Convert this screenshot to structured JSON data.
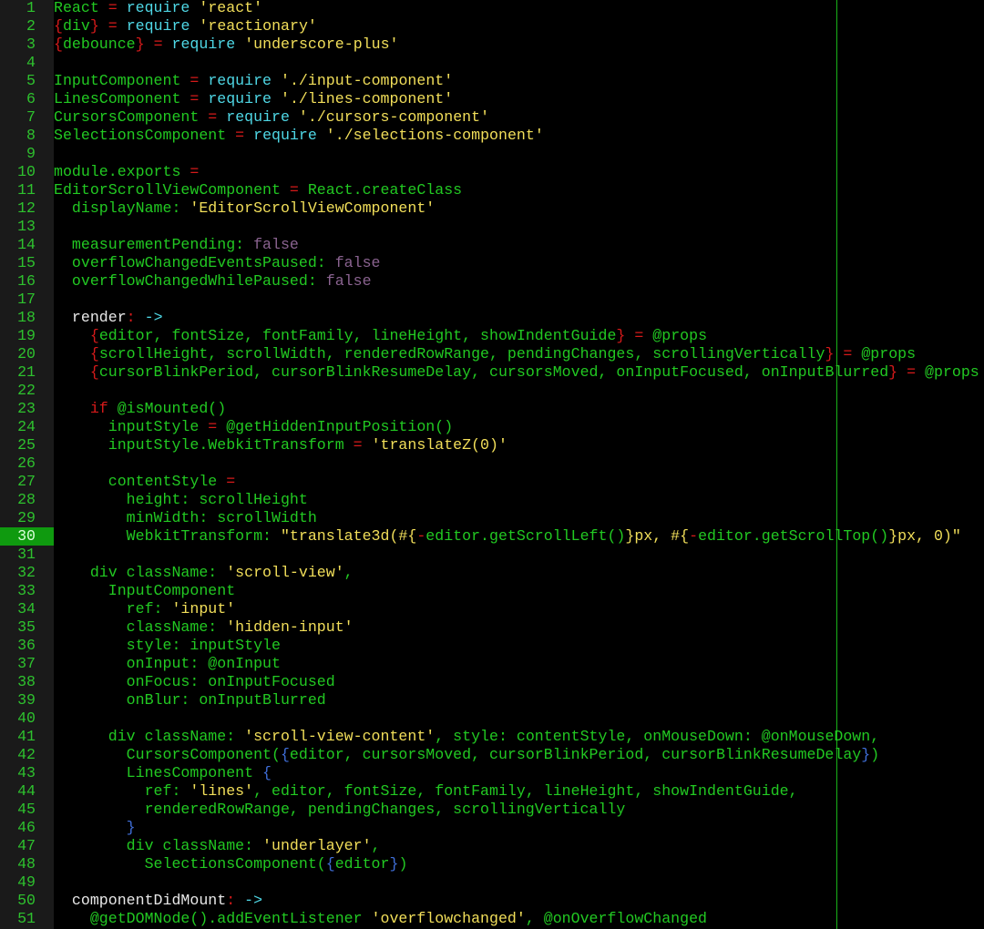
{
  "editor": {
    "cursor_line": 30,
    "colors": {
      "background": "#000000",
      "gutter_bg": "#1a1a1a",
      "line_number": "#2ec22e",
      "current_line_bg": "#0f9a0f",
      "identifier": "#22c922",
      "string": "#f2df5a",
      "keyword": "#4fd8e6",
      "operator": "#d61a1a",
      "boolean": "#8a6390",
      "brace": "#3f6ed8",
      "method_name": "#e8e8e8",
      "wrap_guide": "#19b419"
    },
    "lines": [
      {
        "n": "1",
        "tokens": [
          [
            "def",
            "React "
          ],
          [
            "op",
            "="
          ],
          [
            "def",
            " "
          ],
          [
            "kw",
            "require"
          ],
          [
            "def",
            " "
          ],
          [
            "str",
            "'react'"
          ]
        ]
      },
      {
        "n": "2",
        "tokens": [
          [
            "op",
            "{"
          ],
          [
            "def",
            "div"
          ],
          [
            "op",
            "}"
          ],
          [
            "def",
            " "
          ],
          [
            "op",
            "="
          ],
          [
            "def",
            " "
          ],
          [
            "kw",
            "require"
          ],
          [
            "def",
            " "
          ],
          [
            "str",
            "'reactionary'"
          ]
        ]
      },
      {
        "n": "3",
        "tokens": [
          [
            "op",
            "{"
          ],
          [
            "def",
            "debounce"
          ],
          [
            "op",
            "}"
          ],
          [
            "def",
            " "
          ],
          [
            "op",
            "="
          ],
          [
            "def",
            " "
          ],
          [
            "kw",
            "require"
          ],
          [
            "def",
            " "
          ],
          [
            "str",
            "'underscore-plus'"
          ]
        ]
      },
      {
        "n": "4",
        "tokens": []
      },
      {
        "n": "5",
        "tokens": [
          [
            "def",
            "InputComponent "
          ],
          [
            "op",
            "="
          ],
          [
            "def",
            " "
          ],
          [
            "kw",
            "require"
          ],
          [
            "def",
            " "
          ],
          [
            "str",
            "'./input-component'"
          ]
        ]
      },
      {
        "n": "6",
        "tokens": [
          [
            "def",
            "LinesComponent "
          ],
          [
            "op",
            "="
          ],
          [
            "def",
            " "
          ],
          [
            "kw",
            "require"
          ],
          [
            "def",
            " "
          ],
          [
            "str",
            "'./lines-component'"
          ]
        ]
      },
      {
        "n": "7",
        "tokens": [
          [
            "def",
            "CursorsComponent "
          ],
          [
            "op",
            "="
          ],
          [
            "def",
            " "
          ],
          [
            "kw",
            "require"
          ],
          [
            "def",
            " "
          ],
          [
            "str",
            "'./cursors-component'"
          ]
        ]
      },
      {
        "n": "8",
        "tokens": [
          [
            "def",
            "SelectionsComponent "
          ],
          [
            "op",
            "="
          ],
          [
            "def",
            " "
          ],
          [
            "kw",
            "require"
          ],
          [
            "def",
            " "
          ],
          [
            "str",
            "'./selections-component'"
          ]
        ]
      },
      {
        "n": "9",
        "tokens": []
      },
      {
        "n": "10",
        "tokens": [
          [
            "def",
            "module.exports "
          ],
          [
            "op",
            "="
          ]
        ]
      },
      {
        "n": "11",
        "tokens": [
          [
            "def",
            "EditorScrollViewComponent "
          ],
          [
            "op",
            "="
          ],
          [
            "def",
            " React.createClass"
          ]
        ]
      },
      {
        "n": "12",
        "tokens": [
          [
            "def",
            "  displayName: "
          ],
          [
            "str",
            "'EditorScrollViewComponent'"
          ]
        ]
      },
      {
        "n": "13",
        "tokens": []
      },
      {
        "n": "14",
        "tokens": [
          [
            "def",
            "  measurementPending: "
          ],
          [
            "bool",
            "false"
          ]
        ]
      },
      {
        "n": "15",
        "tokens": [
          [
            "def",
            "  overflowChangedEventsPaused: "
          ],
          [
            "bool",
            "false"
          ]
        ]
      },
      {
        "n": "16",
        "tokens": [
          [
            "def",
            "  overflowChangedWhilePaused: "
          ],
          [
            "bool",
            "false"
          ]
        ]
      },
      {
        "n": "17",
        "tokens": []
      },
      {
        "n": "18",
        "tokens": [
          [
            "wh",
            "  render"
          ],
          [
            "op",
            ":"
          ],
          [
            "def",
            " "
          ],
          [
            "ar",
            "->"
          ]
        ]
      },
      {
        "n": "19",
        "tokens": [
          [
            "def",
            "    "
          ],
          [
            "op",
            "{"
          ],
          [
            "def",
            "editor, fontSize, fontFamily, lineHeight, showIndentGuide"
          ],
          [
            "op",
            "}"
          ],
          [
            "def",
            " "
          ],
          [
            "op",
            "="
          ],
          [
            "def",
            " @props"
          ]
        ]
      },
      {
        "n": "20",
        "tokens": [
          [
            "def",
            "    "
          ],
          [
            "op",
            "{"
          ],
          [
            "def",
            "scrollHeight, scrollWidth, renderedRowRange, pendingChanges, scrollingVertically"
          ],
          [
            "op",
            "}"
          ],
          [
            "def",
            " "
          ],
          [
            "op",
            "="
          ],
          [
            "def",
            " @props"
          ]
        ]
      },
      {
        "n": "21",
        "tokens": [
          [
            "def",
            "    "
          ],
          [
            "op",
            "{"
          ],
          [
            "def",
            "cursorBlinkPeriod, cursorBlinkResumeDelay, cursorsMoved, onInputFocused, onInputBlurred"
          ],
          [
            "op",
            "}"
          ],
          [
            "def",
            " "
          ],
          [
            "op",
            "="
          ],
          [
            "def",
            " @props"
          ]
        ]
      },
      {
        "n": "22",
        "tokens": []
      },
      {
        "n": "23",
        "tokens": [
          [
            "def",
            "    "
          ],
          [
            "if",
            "if"
          ],
          [
            "def",
            " @isMounted()"
          ]
        ]
      },
      {
        "n": "24",
        "tokens": [
          [
            "def",
            "      inputStyle "
          ],
          [
            "op",
            "="
          ],
          [
            "def",
            " @getHiddenInputPosition()"
          ]
        ]
      },
      {
        "n": "25",
        "tokens": [
          [
            "def",
            "      inputStyle.WebkitTransform "
          ],
          [
            "op",
            "="
          ],
          [
            "def",
            " "
          ],
          [
            "str",
            "'translateZ(0)'"
          ]
        ]
      },
      {
        "n": "26",
        "tokens": []
      },
      {
        "n": "27",
        "tokens": [
          [
            "def",
            "      contentStyle "
          ],
          [
            "op",
            "="
          ]
        ]
      },
      {
        "n": "28",
        "tokens": [
          [
            "def",
            "        height: scrollHeight"
          ]
        ]
      },
      {
        "n": "29",
        "tokens": [
          [
            "def",
            "        minWidth: scrollWidth"
          ]
        ]
      },
      {
        "n": "30",
        "tokens": [
          [
            "def",
            "        WebkitTransform: "
          ],
          [
            "str",
            "\"translate3d(#{"
          ],
          [
            "op",
            "-"
          ],
          [
            "def",
            "editor.getScrollLeft()"
          ],
          [
            "str",
            "}px, #{"
          ],
          [
            "op",
            "-"
          ],
          [
            "def",
            "editor.getScrollTop()"
          ],
          [
            "str",
            "}px, 0)\""
          ]
        ]
      },
      {
        "n": "31",
        "tokens": []
      },
      {
        "n": "32",
        "tokens": [
          [
            "def",
            "    div className: "
          ],
          [
            "str",
            "'scroll-view'"
          ],
          [
            "def",
            ","
          ]
        ]
      },
      {
        "n": "33",
        "tokens": [
          [
            "def",
            "      InputComponent"
          ]
        ]
      },
      {
        "n": "34",
        "tokens": [
          [
            "def",
            "        ref: "
          ],
          [
            "str",
            "'input'"
          ]
        ]
      },
      {
        "n": "35",
        "tokens": [
          [
            "def",
            "        className: "
          ],
          [
            "str",
            "'hidden-input'"
          ]
        ]
      },
      {
        "n": "36",
        "tokens": [
          [
            "def",
            "        style: inputStyle"
          ]
        ]
      },
      {
        "n": "37",
        "tokens": [
          [
            "def",
            "        onInput: @onInput"
          ]
        ]
      },
      {
        "n": "38",
        "tokens": [
          [
            "def",
            "        onFocus: onInputFocused"
          ]
        ]
      },
      {
        "n": "39",
        "tokens": [
          [
            "def",
            "        onBlur: onInputBlurred"
          ]
        ]
      },
      {
        "n": "40",
        "tokens": []
      },
      {
        "n": "41",
        "tokens": [
          [
            "def",
            "      div className: "
          ],
          [
            "str",
            "'scroll-view-content'"
          ],
          [
            "def",
            ", style: contentStyle, onMouseDown: @onMouseDown,"
          ]
        ]
      },
      {
        "n": "42",
        "tokens": [
          [
            "def",
            "        CursorsComponent("
          ],
          [
            "br",
            "{"
          ],
          [
            "def",
            "editor, cursorsMoved, cursorBlinkPeriod, cursorBlinkResumeDelay"
          ],
          [
            "br",
            "}"
          ],
          [
            "def",
            ")"
          ]
        ]
      },
      {
        "n": "43",
        "tokens": [
          [
            "def",
            "        LinesComponent "
          ],
          [
            "br",
            "{"
          ]
        ]
      },
      {
        "n": "44",
        "tokens": [
          [
            "def",
            "          ref: "
          ],
          [
            "str",
            "'lines'"
          ],
          [
            "def",
            ", editor, fontSize, fontFamily, lineHeight, showIndentGuide,"
          ]
        ]
      },
      {
        "n": "45",
        "tokens": [
          [
            "def",
            "          renderedRowRange, pendingChanges, scrollingVertically"
          ]
        ]
      },
      {
        "n": "46",
        "tokens": [
          [
            "def",
            "        "
          ],
          [
            "br",
            "}"
          ]
        ]
      },
      {
        "n": "47",
        "tokens": [
          [
            "def",
            "        div className: "
          ],
          [
            "str",
            "'underlayer'"
          ],
          [
            "def",
            ","
          ]
        ]
      },
      {
        "n": "48",
        "tokens": [
          [
            "def",
            "          SelectionsComponent("
          ],
          [
            "br",
            "{"
          ],
          [
            "def",
            "editor"
          ],
          [
            "br",
            "}"
          ],
          [
            "def",
            ")"
          ]
        ]
      },
      {
        "n": "49",
        "tokens": []
      },
      {
        "n": "50",
        "tokens": [
          [
            "wh",
            "  componentDidMount"
          ],
          [
            "op",
            ":"
          ],
          [
            "def",
            " "
          ],
          [
            "ar",
            "->"
          ]
        ]
      },
      {
        "n": "51",
        "tokens": [
          [
            "def",
            "    @getDOMNode().addEventListener "
          ],
          [
            "str",
            "'overflowchanged'"
          ],
          [
            "def",
            ", @onOverflowChanged"
          ]
        ]
      }
    ]
  }
}
